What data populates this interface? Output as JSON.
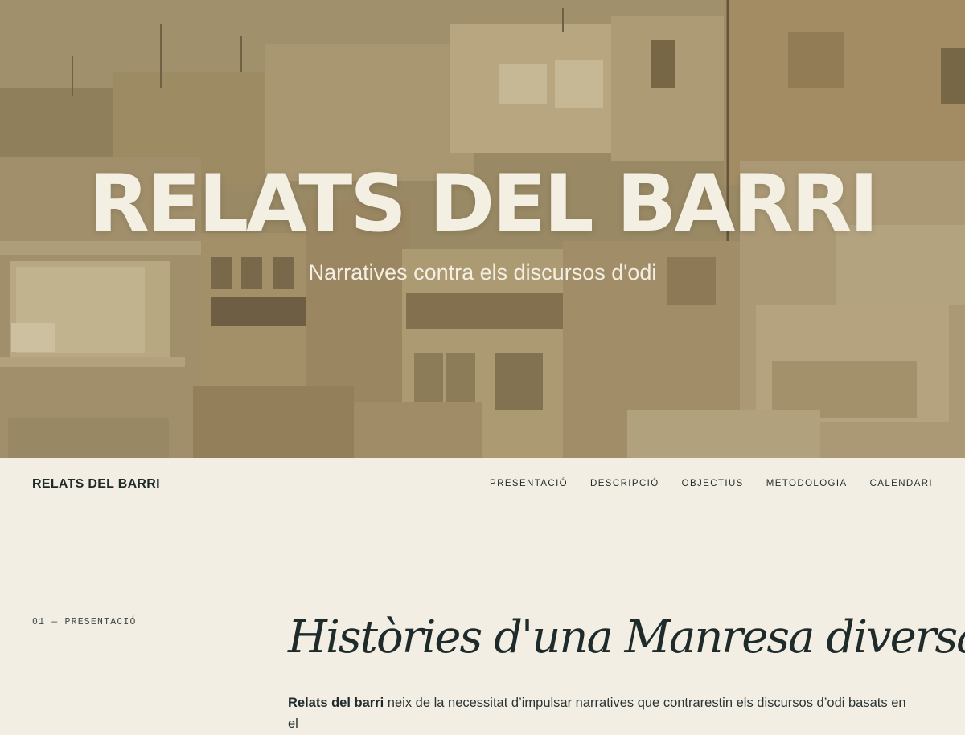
{
  "hero": {
    "title": "RELATS DEL BARRI",
    "subtitle": "Narratives contra els discursos d'odi",
    "photo_icon": "city-rooftops-photo"
  },
  "nav": {
    "brand": "RELATS DEL BARRI",
    "items": [
      {
        "label": "PRESENTACIÓ"
      },
      {
        "label": "DESCRIPCIÓ"
      },
      {
        "label": "OBJECTIUS"
      },
      {
        "label": "METODOLOGIA"
      },
      {
        "label": "CALENDARI"
      }
    ]
  },
  "section": {
    "label": "01 — PRESENTACIÓ",
    "title": "Històries d'una Manresa diversa",
    "intro_bold": "Relats del barri",
    "intro_rest": " neix de la necessitat d’impulsar narratives que contrarestin els discursos d’odi basats en el"
  },
  "colors": {
    "background": "#f2eee4",
    "text": "#1f2b2b",
    "hero_text": "#f4efe3"
  }
}
